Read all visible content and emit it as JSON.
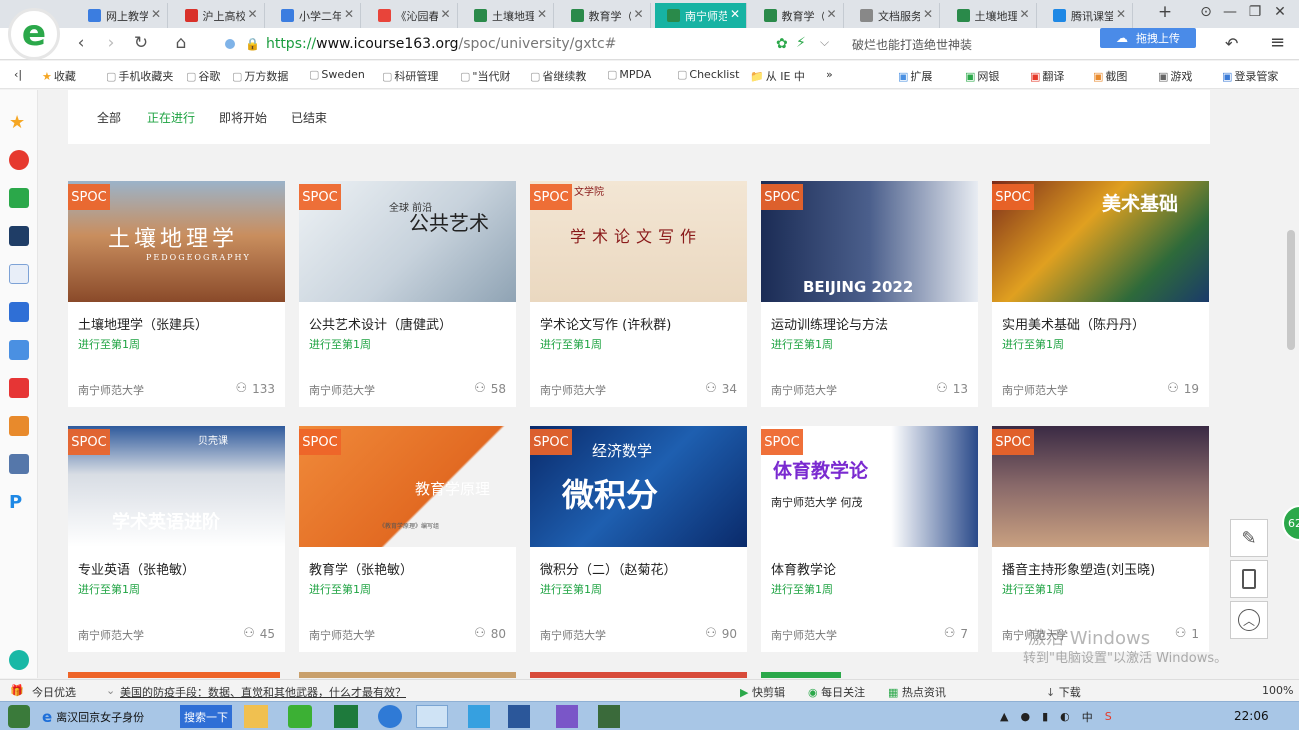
{
  "browser": {
    "tabs": [
      {
        "label": "网上教学",
        "color": "#3b7de0",
        "active": false
      },
      {
        "label": "沪上高校",
        "color": "#d9312a",
        "active": false
      },
      {
        "label": "小学二年",
        "color": "#3b7de0",
        "active": false
      },
      {
        "label": "《沁园春",
        "color": "#e8443a",
        "active": false
      },
      {
        "label": "土壤地理",
        "color": "#2a8a4a",
        "active": false
      },
      {
        "label": "教育学（",
        "color": "#2a8a4a",
        "active": false
      },
      {
        "label": "南宁师范",
        "color": "#2a8a4a",
        "active": true
      },
      {
        "label": "教育学（",
        "color": "#2a8a4a",
        "active": false
      },
      {
        "label": "文档服务",
        "color": "#888888",
        "active": false
      },
      {
        "label": "土壤地理",
        "color": "#2a8a4a",
        "active": false
      },
      {
        "label": "腾讯课堂",
        "color": "#1e88e5",
        "active": false
      }
    ],
    "url_scheme": "https://",
    "url_host": "www.icourse163.org",
    "url_path": "/spoc/university/gxtc#",
    "search_hint": "破烂也能打造绝世神装",
    "upload_label": "拖拽上传"
  },
  "bookmarks": [
    "收藏",
    "手机收藏夹",
    "谷歌",
    "万方数据",
    "Sweden",
    "科研管理",
    "\"当代财",
    "省继续教",
    "MPDA",
    "Checklist",
    "从 IE 中"
  ],
  "toolbar_right": [
    "扩展",
    "网银",
    "翻译",
    "截图",
    "游戏",
    "登录管家"
  ],
  "filters": {
    "all": "全部",
    "ongoing": "正在进行",
    "upcoming": "即将开始",
    "ended": "已结束"
  },
  "spoc_badge": "SPOC",
  "courses": [
    {
      "title": "土壤地理学（张建兵）",
      "progress": "进行至第1周",
      "university": "南宁师范大学",
      "count": "133",
      "thumb_text": "土壤地理学",
      "thumb_sub": "PEDOGEOGRAPHY"
    },
    {
      "title": "公共艺术设计（唐健武）",
      "progress": "进行至第1周",
      "university": "南宁师范大学",
      "count": "58",
      "thumb_text": "公共艺术",
      "thumb_sub": "全球 前沿"
    },
    {
      "title": "学术论文写作 (许秋群)",
      "progress": "进行至第1周",
      "university": "南宁师范大学",
      "count": "34",
      "thumb_text": "学术论文写作",
      "thumb_sub": "文学院"
    },
    {
      "title": "运动训练理论与方法",
      "progress": "进行至第1周",
      "university": "南宁师范大学",
      "count": "13",
      "thumb_text": "BEIJING 2022",
      "thumb_sub": ""
    },
    {
      "title": "实用美术基础（陈丹丹）",
      "progress": "进行至第1周",
      "university": "南宁师范大学",
      "count": "19",
      "thumb_text": "美术基础",
      "thumb_sub": ""
    },
    {
      "title": "专业英语（张艳敏）",
      "progress": "进行至第1周",
      "university": "南宁师范大学",
      "count": "45",
      "thumb_text": "学术英语进阶",
      "thumb_sub": "贝壳课"
    },
    {
      "title": "教育学（张艳敏）",
      "progress": "进行至第1周",
      "university": "南宁师范大学",
      "count": "80",
      "thumb_text": "教育学原理",
      "thumb_sub": "《教育学原理》编写组"
    },
    {
      "title": "微积分（二）（赵菊花）",
      "progress": "进行至第1周",
      "university": "南宁师范大学",
      "count": "90",
      "thumb_text": "微积分",
      "thumb_sub": "经济数学"
    },
    {
      "title": "体育教学论",
      "progress": "进行至第1周",
      "university": "南宁师范大学",
      "count": "7",
      "thumb_text": "体育教学论",
      "thumb_sub": "南宁师范大学 何茂"
    },
    {
      "title": "播音主持形象塑造(刘玉晓)",
      "progress": "进行至第1周",
      "university": "南宁师范大学",
      "count": "1",
      "thumb_text": "",
      "thumb_sub": ""
    }
  ],
  "watermark": {
    "line1": "激活 Windows",
    "line2": "转到\"电脑设置\"以激活 Windows。"
  },
  "newsbar": {
    "today": "今日优选",
    "headline": "美国的防疫手段：数据、直觉和其他武器，什么才最有效？",
    "items": [
      "快剪辑",
      "每日关注",
      "热点资讯",
      "下载"
    ],
    "zoom": "100%"
  },
  "taskbar": {
    "window_title": "离汉回京女子身份",
    "search_label": "搜索一下",
    "clock": "22:06",
    "ime": "中"
  },
  "float_badge": "62"
}
